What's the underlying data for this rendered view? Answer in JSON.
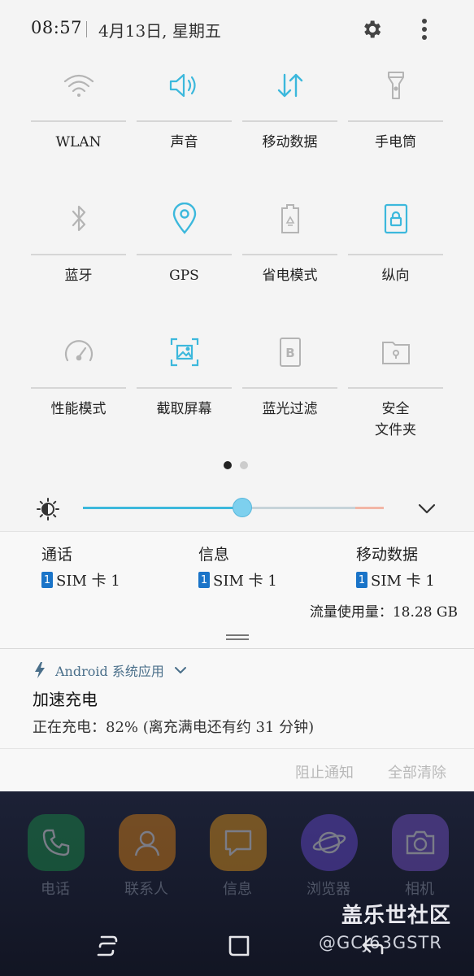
{
  "status_bar": {
    "time": "08:57",
    "date": "4月13日, 星期五",
    "settings_icon": "gear-icon",
    "more_icon": "more-vertical-icon"
  },
  "quick_settings": {
    "tiles": [
      {
        "label": "WLAN",
        "icon": "wifi-icon",
        "active": false
      },
      {
        "label": "声音",
        "icon": "speaker-icon",
        "active": true
      },
      {
        "label": "移动数据",
        "icon": "data-arrows-icon",
        "active": true
      },
      {
        "label": "手电筒",
        "icon": "flashlight-icon",
        "active": false
      },
      {
        "label": "蓝牙",
        "icon": "bluetooth-icon",
        "active": false
      },
      {
        "label": "GPS",
        "icon": "location-pin-icon",
        "active": true
      },
      {
        "label": "省电模式",
        "icon": "battery-saver-icon",
        "active": false
      },
      {
        "label": "纵向",
        "icon": "portrait-lock-icon",
        "active": true
      },
      {
        "label": "性能模式",
        "icon": "gauge-icon",
        "active": false
      },
      {
        "label": "截取屏幕",
        "icon": "screenshot-icon",
        "active": true
      },
      {
        "label": "蓝光过滤",
        "icon": "blue-light-filter-icon",
        "active": false
      },
      {
        "label": "安全\n文件夹",
        "icon": "secure-folder-icon",
        "active": false
      }
    ],
    "page_count": 2,
    "current_page": 1
  },
  "brightness": {
    "icon": "brightness-icon",
    "level": 0.53,
    "expand_icon": "chevron-down-icon"
  },
  "sim_info": {
    "columns": [
      {
        "title": "通话",
        "sim_number": "1",
        "sim_label": "SIM 卡 1"
      },
      {
        "title": "信息",
        "sim_number": "1",
        "sim_label": "SIM 卡 1"
      },
      {
        "title": "移动数据",
        "sim_number": "1",
        "sim_label": "SIM 卡 1"
      }
    ],
    "data_usage": "流量使用量：18.28 GB"
  },
  "notification": {
    "app_icon": "bolt-icon",
    "app_name": "Android 系统应用",
    "title": "加速充电",
    "body": "正在充电：82% (离充满电还有约 31 分钟)",
    "actions": {
      "block": "阻止通知",
      "clear_all": "全部清除"
    }
  },
  "homescreen": {
    "apps": [
      {
        "label": "电话",
        "icon": "phone-icon",
        "color": "#1a9a4a"
      },
      {
        "label": "联系人",
        "icon": "contacts-icon",
        "color": "#f08c10"
      },
      {
        "label": "信息",
        "icon": "message-icon",
        "color": "#f5a014"
      },
      {
        "label": "浏览器",
        "icon": "browser-planet-icon",
        "color": "#6e4de0"
      },
      {
        "label": "相机",
        "icon": "camera-icon",
        "color": "#7e57d8"
      }
    ],
    "watermark_title": "盖乐世社区",
    "watermark_handle": "@GCJ63GSTR"
  },
  "nav_bar": {
    "recents_icon": "recents-icon",
    "home_icon": "home-icon",
    "back_icon": "back-icon"
  },
  "colors": {
    "accent": "#3cb8dc",
    "inactive_icon": "#b4b4b4"
  }
}
